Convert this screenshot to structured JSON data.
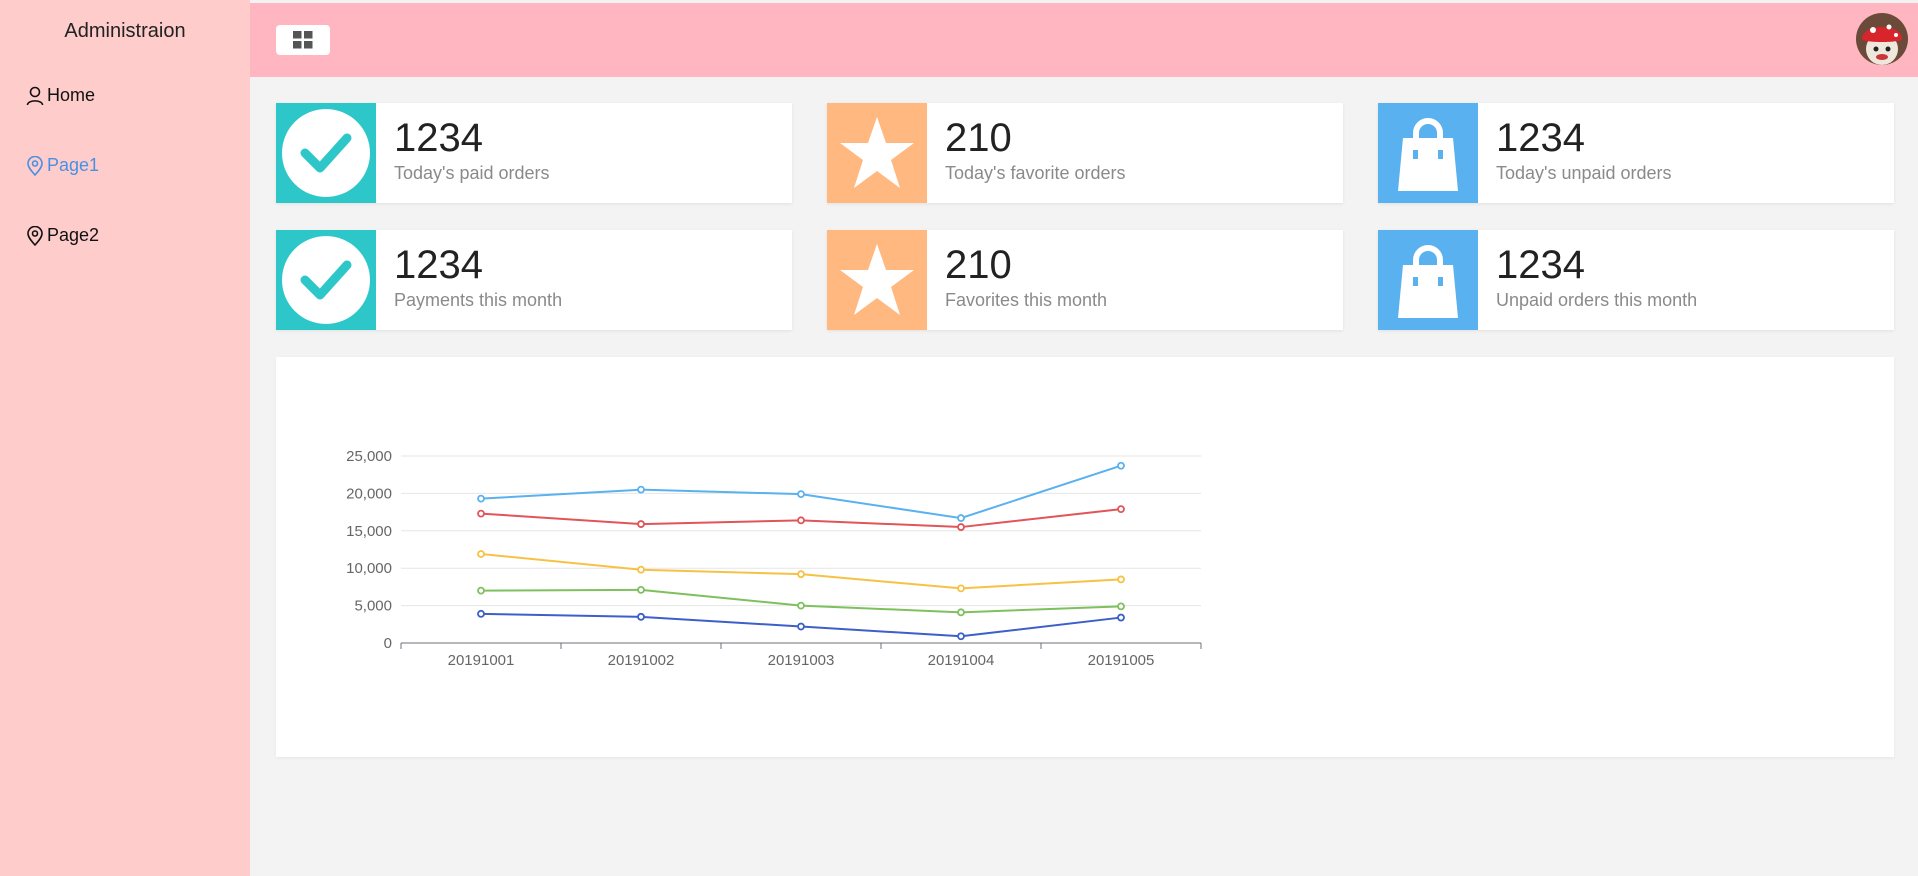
{
  "sidebar": {
    "title": "Administraion",
    "items": [
      {
        "label": "Home",
        "icon": "user-icon"
      },
      {
        "label": "Page1",
        "icon": "location-pin-icon",
        "active": true
      },
      {
        "label": "Page2",
        "icon": "location-pin-icon"
      }
    ]
  },
  "header": {
    "menu_icon": "grid-icon",
    "avatar": "user-avatar"
  },
  "colors": {
    "sidebar_bg": "#ffcccc",
    "header_bg": "#ffb6c1",
    "teal": "#2ec7c9",
    "orange": "#ffb980",
    "blue": "#5ab1ef",
    "active_link": "#4a90e2"
  },
  "cards": [
    {
      "value": "1234",
      "label": "Today's paid orders",
      "icon": "check-icon",
      "color": "#2ec7c9"
    },
    {
      "value": "210",
      "label": "Today's favorite orders",
      "icon": "star-icon",
      "color": "#ffb980"
    },
    {
      "value": "1234",
      "label": "Today's unpaid orders",
      "icon": "shopping-bag-icon",
      "color": "#5ab1ef"
    },
    {
      "value": "1234",
      "label": "Payments this month",
      "icon": "check-icon",
      "color": "#2ec7c9"
    },
    {
      "value": "210",
      "label": "Favorites this month",
      "icon": "star-icon",
      "color": "#ffb980"
    },
    {
      "value": "1234",
      "label": "Unpaid orders this month",
      "icon": "shopping-bag-icon",
      "color": "#5ab1ef"
    }
  ],
  "chart_data": {
    "type": "line",
    "categories": [
      "20191001",
      "20191002",
      "20191003",
      "20191004",
      "20191005"
    ],
    "ylim": [
      0,
      25000
    ],
    "yticks": [
      0,
      5000,
      10000,
      15000,
      20000,
      25000
    ],
    "ytick_labels": [
      "0",
      "5,000",
      "10,000",
      "15,000",
      "20,000",
      "25,000"
    ],
    "series": [
      {
        "color": "#5ab1ef",
        "values": [
          19300,
          20500,
          19900,
          16700,
          23700
        ]
      },
      {
        "color": "#e15457",
        "values": [
          17300,
          15900,
          16400,
          15500,
          17900
        ]
      },
      {
        "color": "#f7c244",
        "values": [
          11900,
          9800,
          9200,
          7300,
          8500
        ]
      },
      {
        "color": "#7ec05e",
        "values": [
          7000,
          7100,
          5000,
          4100,
          4900
        ]
      },
      {
        "color": "#3c5fc8",
        "values": [
          3900,
          3500,
          2200,
          900,
          3400
        ]
      }
    ],
    "grid": true
  }
}
